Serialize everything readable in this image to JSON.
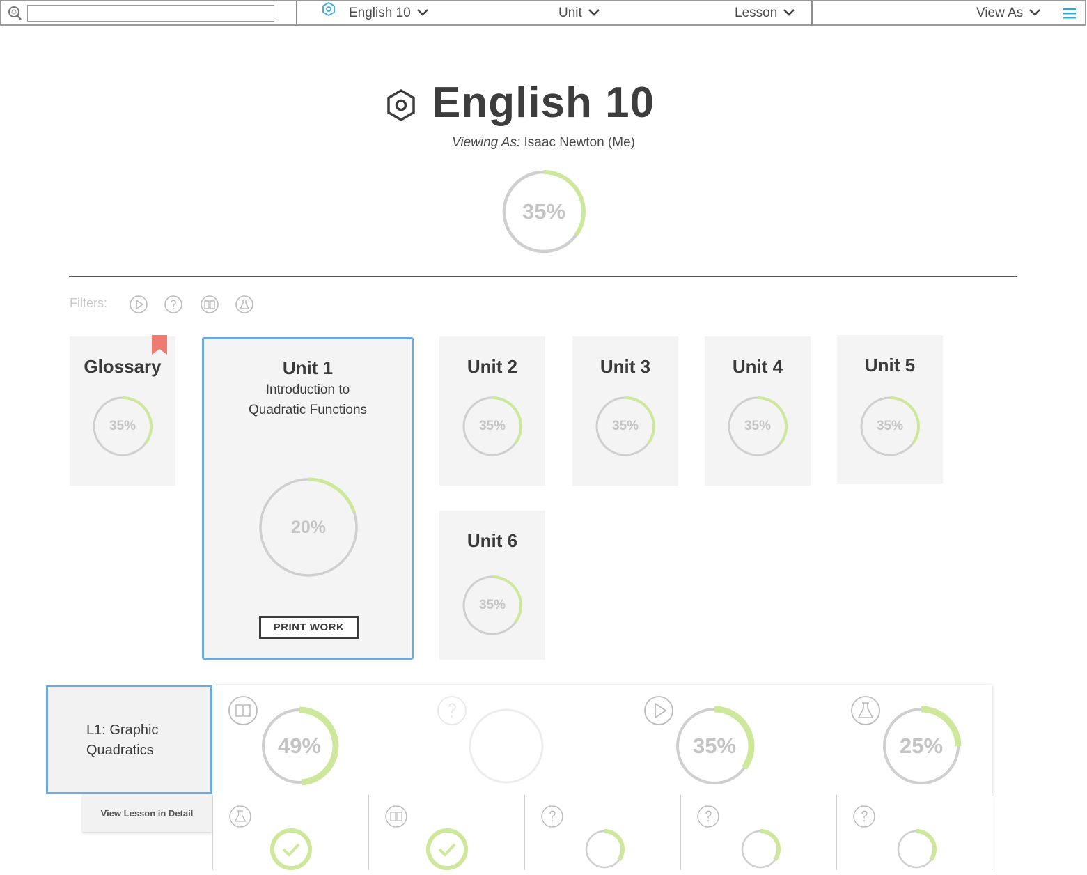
{
  "topbar": {
    "search_placeholder": "",
    "course_label": "English 10",
    "unit_label": "Unit",
    "lesson_label": "Lesson",
    "view_as_label": "View As"
  },
  "header": {
    "title": "English 10",
    "viewing_as_prefix": "Viewing As:",
    "viewing_as_name": "Isaac Newton (Me)",
    "overall_progress": 35,
    "overall_label": "35%"
  },
  "filters": {
    "label": "Filters:",
    "icons": [
      "play-icon",
      "question-icon",
      "book-icon",
      "flask-icon"
    ]
  },
  "cards": [
    {
      "title": "Glossary",
      "progress": 35,
      "label": "35%",
      "bookmarked": true
    },
    {
      "title": "Unit 1",
      "subtitle_1": "Introduction to",
      "subtitle_2": "Quadratic Functions",
      "progress": 20,
      "label": "20%",
      "button": "PRINT WORK"
    },
    {
      "title": "Unit 2",
      "progress": 35,
      "label": "35%"
    },
    {
      "title": "Unit 3",
      "progress": 35,
      "label": "35%"
    },
    {
      "title": "Unit 4",
      "progress": 35,
      "label": "35%"
    },
    {
      "title": "Unit 5",
      "progress": 35,
      "label": "35%"
    },
    {
      "title": "Unit 6",
      "progress": 35,
      "label": "35%"
    }
  ],
  "lesson": {
    "label_1": "L1:  Graphic",
    "label_2": "Quadratics",
    "view_detail": "View Lesson in Detail",
    "types": [
      {
        "icon": "book-icon",
        "progress": 49,
        "label": "49%"
      },
      {
        "icon": "question-icon",
        "progress": 0,
        "label": ""
      },
      {
        "icon": "play-icon",
        "progress": 35,
        "label": "35%"
      },
      {
        "icon": "flask-icon",
        "progress": 25,
        "label": "25%"
      }
    ]
  },
  "activities": [
    {
      "icon": "flask-icon",
      "status": "complete"
    },
    {
      "icon": "book-icon",
      "status": "complete"
    },
    {
      "icon": "question-icon",
      "status": "partial",
      "progress": 35
    },
    {
      "icon": "question-icon",
      "status": "partial",
      "progress": 35
    },
    {
      "icon": "question-icon",
      "status": "partial",
      "progress": 35
    }
  ],
  "colors": {
    "accent": "#6ea9dc",
    "progress": "#cde89a",
    "ring": "#cfcfcf",
    "bookmark": "#ee7b6f",
    "menu": "#3aa6d8"
  }
}
